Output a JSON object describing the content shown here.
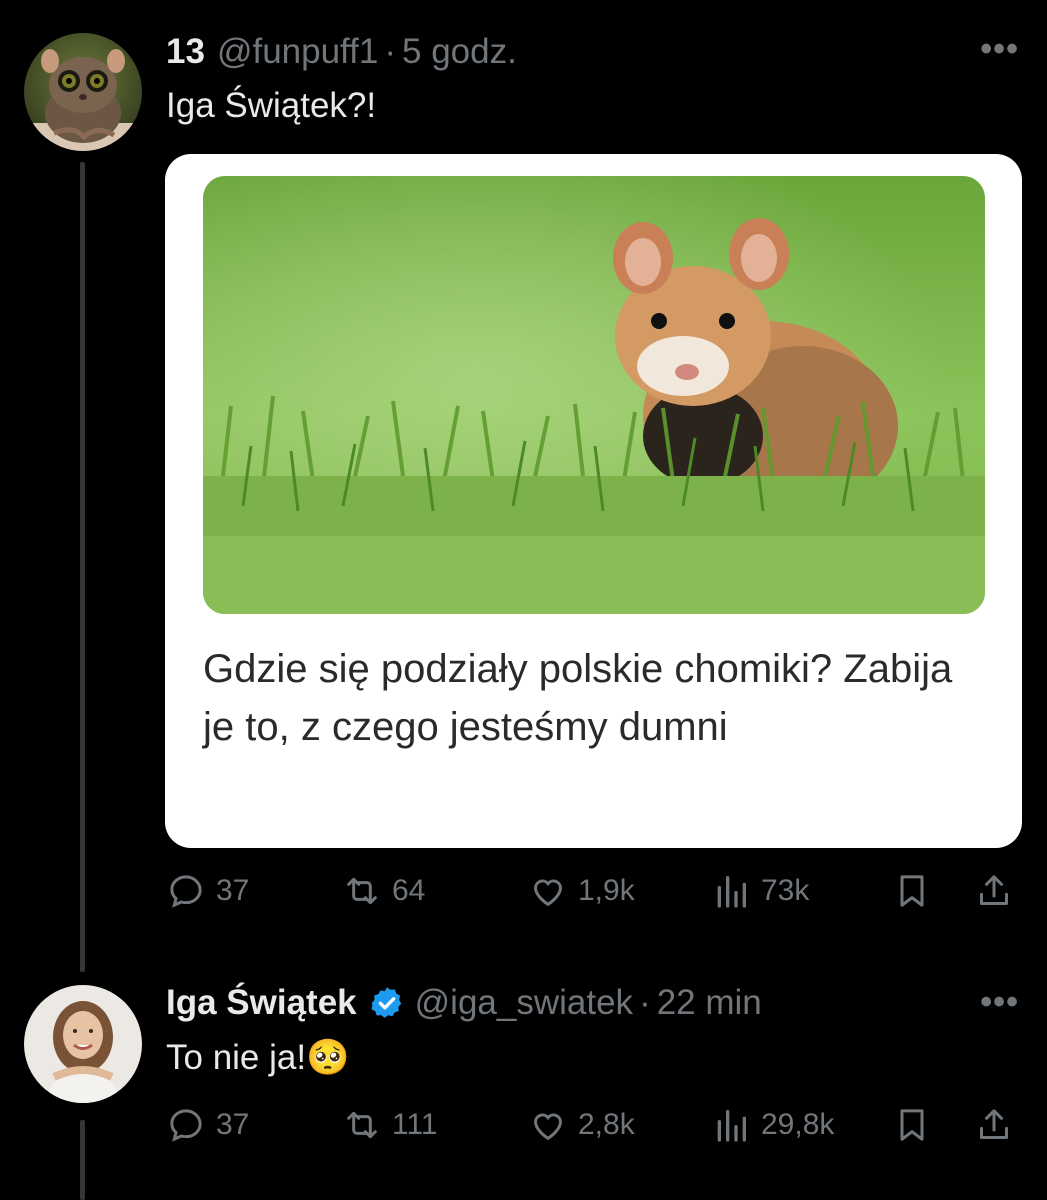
{
  "tweets": [
    {
      "display_name": "13",
      "handle": "@funpuff1",
      "separator": "·",
      "time": "5 godz.",
      "text": "Iga Świątek?!",
      "more": "•••",
      "card": {
        "headline": "Gdzie się podziały polskie chomiki? Zabija je to, z czego jesteśmy dumni"
      },
      "actions": {
        "replies": "37",
        "reposts": "64",
        "likes": "1,9k",
        "views": "73k"
      }
    },
    {
      "display_name": "Iga Świątek",
      "handle": "@iga_swiatek",
      "separator": "·",
      "time": "22 min",
      "text": "To nie ja!",
      "emoji": "🥺",
      "more": "•••",
      "actions": {
        "replies": "37",
        "reposts": "111",
        "likes": "2,8k",
        "views": "29,8k"
      }
    }
  ],
  "colors": {
    "background": "#000000",
    "text": "#e7e9ea",
    "muted": "#71767b",
    "verified": "#1d9bf0"
  }
}
